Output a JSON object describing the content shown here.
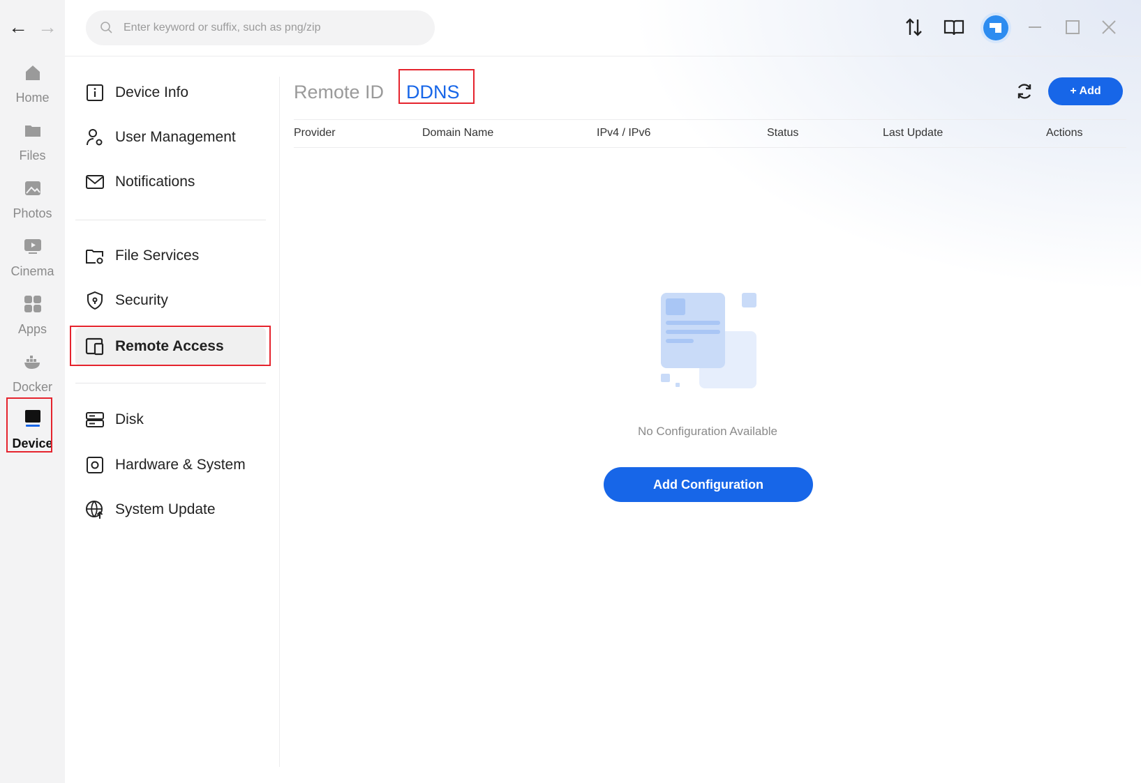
{
  "search": {
    "placeholder": "Enter keyword or suffix, such as png/zip"
  },
  "rail": {
    "items": [
      {
        "label": "Home",
        "icon": "home-icon"
      },
      {
        "label": "Files",
        "icon": "folder-icon"
      },
      {
        "label": "Photos",
        "icon": "photo-icon"
      },
      {
        "label": "Cinema",
        "icon": "play-icon"
      },
      {
        "label": "Apps",
        "icon": "apps-grid-icon"
      },
      {
        "label": "Docker",
        "icon": "docker-icon"
      },
      {
        "label": "Device",
        "icon": "device-icon"
      }
    ],
    "active": "Device"
  },
  "menu": {
    "items": [
      {
        "label": "Device Info",
        "icon": "info-icon"
      },
      {
        "label": "User Management",
        "icon": "user-gear-icon"
      },
      {
        "label": "Notifications",
        "icon": "mail-icon"
      },
      {
        "label": "File Services",
        "icon": "folder-gear-icon"
      },
      {
        "label": "Security",
        "icon": "shield-icon"
      },
      {
        "label": "Remote Access",
        "icon": "remote-devices-icon"
      },
      {
        "label": "Disk",
        "icon": "disk-icon"
      },
      {
        "label": "Hardware & System",
        "icon": "hardware-icon"
      },
      {
        "label": "System Update",
        "icon": "globe-update-icon"
      }
    ],
    "active": "Remote Access"
  },
  "tabs": [
    {
      "label": "Remote ID"
    },
    {
      "label": "DDNS"
    }
  ],
  "active_tab": "DDNS",
  "toolbar": {
    "add_label": "+ Add"
  },
  "table": {
    "columns": [
      "Provider",
      "Domain Name",
      "IPv4 / IPv6",
      "Status",
      "Last Update",
      "Actions"
    ]
  },
  "empty": {
    "message": "No Configuration Available",
    "button_label": "Add Configuration"
  },
  "colors": {
    "accent": "#1766e8",
    "highlight_box": "#e5232d"
  }
}
